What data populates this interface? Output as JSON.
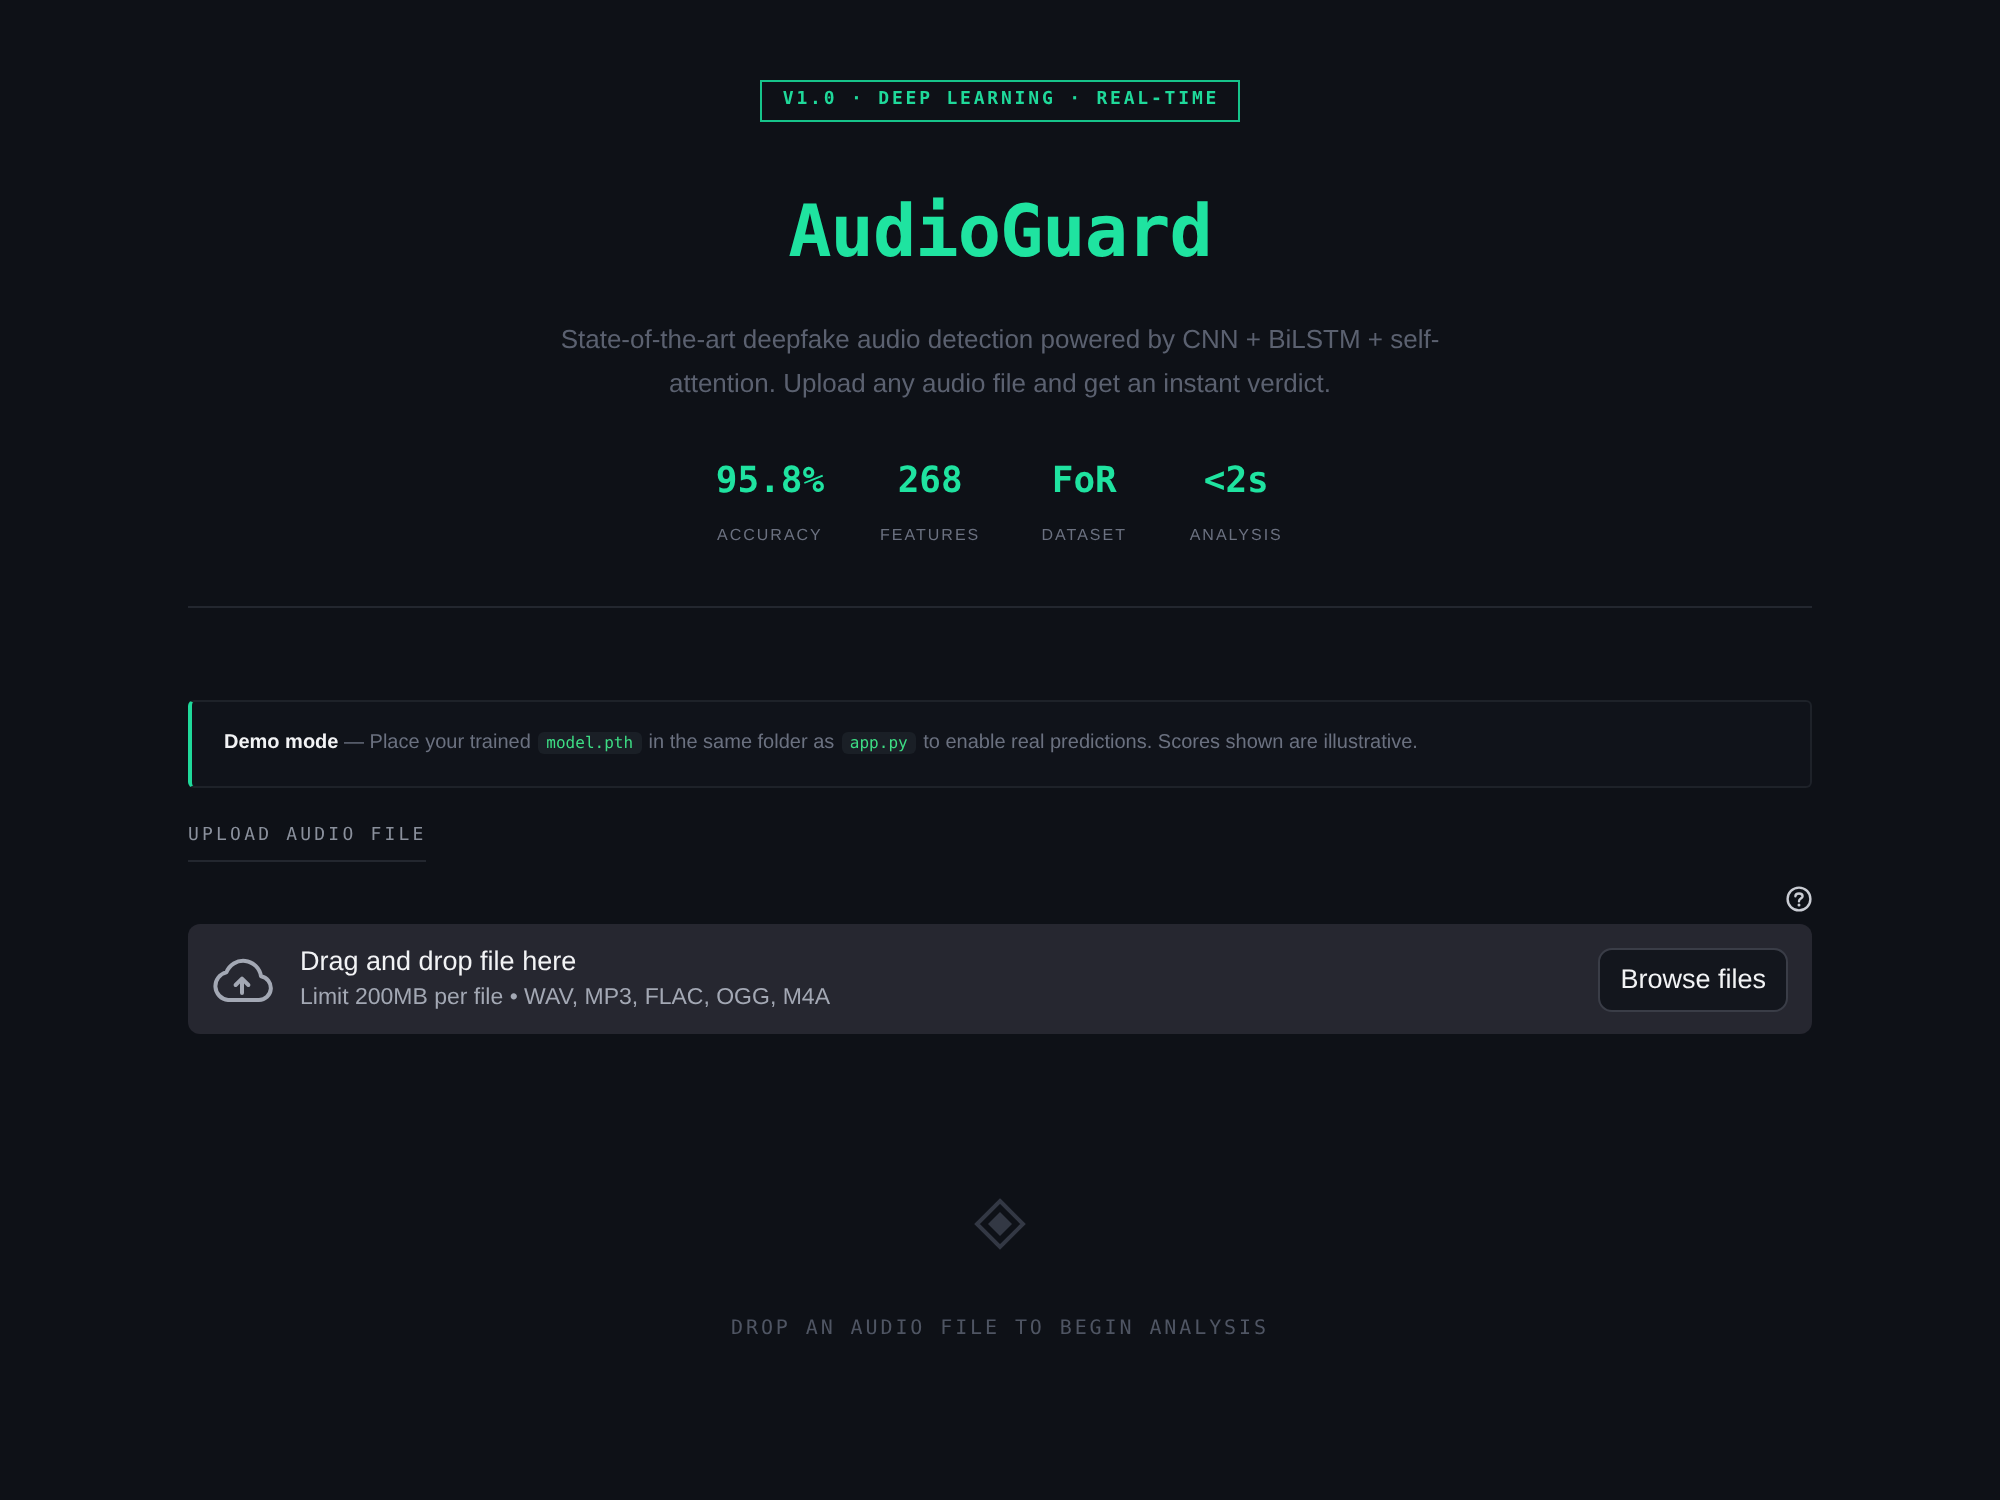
{
  "badge": {
    "text": "V1.0 · DEEP LEARNING · REAL-TIME"
  },
  "title": "AudioGuard",
  "subtitle": "State-of-the-art deepfake audio detection powered by CNN + BiLSTM + self-attention. Upload any audio file and get an instant verdict.",
  "stats": [
    {
      "value": "95.8%",
      "label": "ACCURACY"
    },
    {
      "value": "268",
      "label": "FEATURES"
    },
    {
      "value": "FoR",
      "label": "DATASET"
    },
    {
      "value": "<2s",
      "label": "ANALYSIS"
    }
  ],
  "notice": {
    "parts": [
      {
        "kind": "text",
        "text": "**Demo mode** — Place your trained "
      },
      {
        "kind": "code",
        "text": "model.pth"
      },
      {
        "kind": "text",
        "text": " in the same folder as "
      },
      {
        "kind": "code",
        "text": "app.py"
      },
      {
        "kind": "text",
        "text": " to enable real predictions. Scores shown are illustrative."
      }
    ]
  },
  "upload": {
    "label": "UPLOAD AUDIO FILE",
    "dropzone": {
      "title": "Drag and drop file here",
      "hint": "Limit 200MB per file • WAV, MP3, FLAC, OGG, M4A",
      "button": "Browse files"
    }
  },
  "empty_state": {
    "message": "DROP AN AUDIO FILE TO BEGIN ANALYSIS"
  }
}
